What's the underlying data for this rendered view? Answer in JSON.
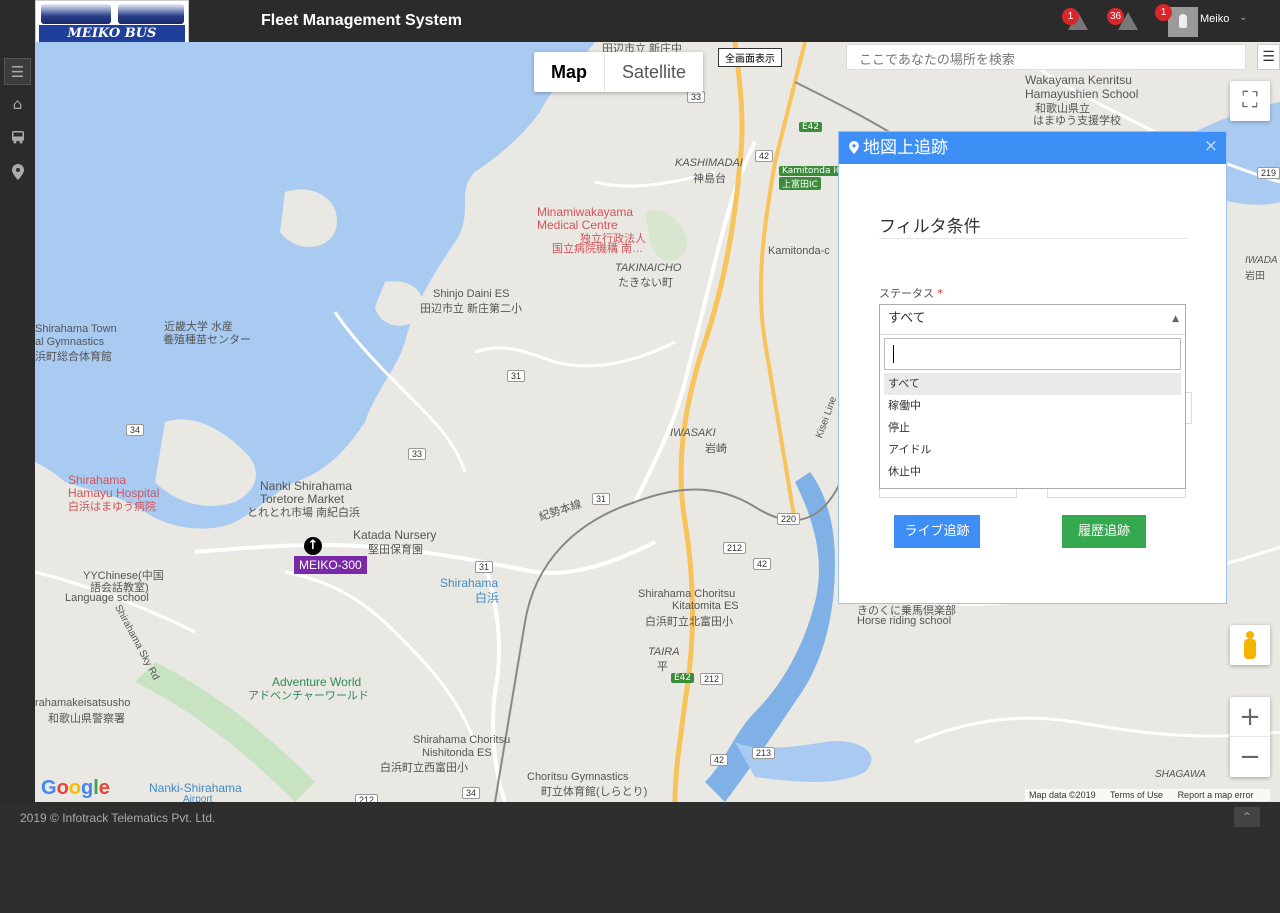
{
  "header": {
    "logo_text": "MEIKO BUS",
    "title": "Fleet Management System",
    "alerts": [
      {
        "count": "1",
        "icon": "warning-icon"
      },
      {
        "count": "36",
        "icon": "warning-icon"
      },
      {
        "count": "1",
        "icon": "user-icon"
      }
    ],
    "user_name": "Meiko"
  },
  "sidebar": {
    "items": [
      {
        "icon": "menu-icon"
      },
      {
        "icon": "home-icon"
      },
      {
        "icon": "bus-icon"
      },
      {
        "icon": "map-marker-icon"
      }
    ]
  },
  "map": {
    "map_type": {
      "map": "Map",
      "satellite": "Satellite"
    },
    "fullscreen_label": "全画面表示",
    "search_placeholder": "ここであなたの場所を検索",
    "vehicle": {
      "label": "MEIKO-300"
    },
    "attribution": {
      "data": "Map data ©2019",
      "terms": "Terms of Use",
      "report": "Report a map error"
    },
    "labels": [
      {
        "text": "田辺市立 新庄中"
      },
      {
        "text": "Wakayama Kenritsu"
      },
      {
        "text": "Hamayushien School"
      },
      {
        "text": "和歌山県立"
      },
      {
        "text": "はまゆう支援学校"
      },
      {
        "text": "KASHIMADAI"
      },
      {
        "text": "神島台"
      },
      {
        "text": "Kamitonda IC"
      },
      {
        "text": "上富田IC"
      },
      {
        "text": "Minamiwakayama"
      },
      {
        "text": "Medical Centre"
      },
      {
        "text": "独立行政法人"
      },
      {
        "text": "国立病院機構 南…"
      },
      {
        "text": "Kamitonda-c"
      },
      {
        "text": "TAKINAICHO"
      },
      {
        "text": "たきない町"
      },
      {
        "text": "Shinjo Daini ES"
      },
      {
        "text": "田辺市立 新庄第二小"
      },
      {
        "text": "Shirahama Town"
      },
      {
        "text": "al Gymnastics"
      },
      {
        "text": "浜町総合体育館"
      },
      {
        "text": "近畿大学 水産"
      },
      {
        "text": "養殖種苗センター"
      },
      {
        "text": "IWASAKI"
      },
      {
        "text": "岩崎"
      },
      {
        "text": "Shirahama"
      },
      {
        "text": "Hamayu Hospital"
      },
      {
        "text": "白浜はまゆう病院"
      },
      {
        "text": "Nanki Shirahama"
      },
      {
        "text": "Toretore Market"
      },
      {
        "text": "とれとれ市場 南紀白浜"
      },
      {
        "text": "Katada Nursery"
      },
      {
        "text": "堅田保育園"
      },
      {
        "text": "YYChinese(中国"
      },
      {
        "text": "語会話教室)"
      },
      {
        "text": "Language school"
      },
      {
        "text": "Shirahama"
      },
      {
        "text": "白浜"
      },
      {
        "text": "紀勢本線"
      },
      {
        "text": "Shirahama Choritsu"
      },
      {
        "text": "Kitatomita ES"
      },
      {
        "text": "白浜町立北富田小"
      },
      {
        "text": "きのくに乗馬倶楽部"
      },
      {
        "text": "Horse riding school"
      },
      {
        "text": "TAIRA"
      },
      {
        "text": "平"
      },
      {
        "text": "Adventure World"
      },
      {
        "text": "アドベンチャーワールド"
      },
      {
        "text": "rahamakeisatsusho"
      },
      {
        "text": "和歌山県警察署"
      },
      {
        "text": "Shirahama Choritsu"
      },
      {
        "text": "Nishitonda ES"
      },
      {
        "text": "白浜町立西富田小"
      },
      {
        "text": "Nanki-Shirahama"
      },
      {
        "text": "Airport"
      },
      {
        "text": "Choritsu Gymnastics"
      },
      {
        "text": "町立体育館(しらとり)"
      },
      {
        "text": "SHAGAWA"
      },
      {
        "text": "IWADA"
      },
      {
        "text": "岩田"
      },
      {
        "text": "Shirahama Sky Rd"
      },
      {
        "text": "Kisei Line"
      }
    ],
    "route_shields": [
      "33",
      "42",
      "E42",
      "219",
      "34",
      "33",
      "31",
      "31",
      "31",
      "220",
      "212",
      "42",
      "E42",
      "212",
      "213",
      "42",
      "34",
      "212"
    ]
  },
  "panel": {
    "title": "地図上追跡",
    "filter_title": "フィルタ条件",
    "status_label": "ステータス",
    "required_mark": "*",
    "selected": "すべて",
    "options": [
      "すべて",
      "稼働中",
      "停止",
      "アイドル",
      "休止中"
    ],
    "live_button": "ライブ追跡",
    "history_button": "履歴追跡"
  },
  "footer": {
    "copyright": "2019 © Infotrack Telematics Pvt. Ltd."
  }
}
